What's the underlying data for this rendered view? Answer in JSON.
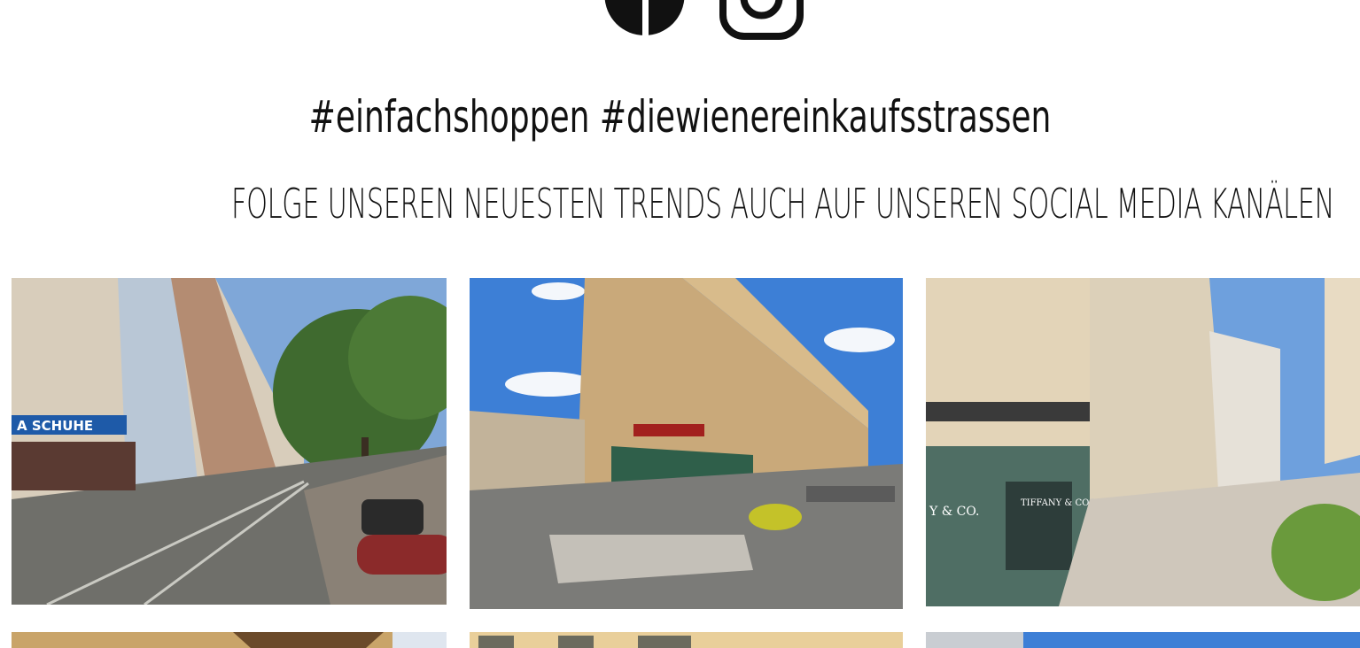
{
  "social": {
    "icons": [
      "facebook-icon",
      "instagram-icon"
    ]
  },
  "heading": {
    "hashtags": "#einfachshoppen #diewienereinkaufsstrassen",
    "subtitle": "FOLGE UNSEREN NEUESTEN TRENDS AUCH AUF UNSEREN SOCIAL MEDIA KANÄLEN"
  },
  "gallery": {
    "row1": [
      {
        "shop_sign": "A SCHUHE"
      },
      {
        "shop_sign": ""
      },
      {
        "shop_sign_left": "Y & CO.",
        "shop_sign_right": "TIFFANY & CO."
      }
    ]
  },
  "colors": {
    "text": "#111111",
    "sky": "#3d7fd6",
    "facade": "#c9a97a"
  }
}
